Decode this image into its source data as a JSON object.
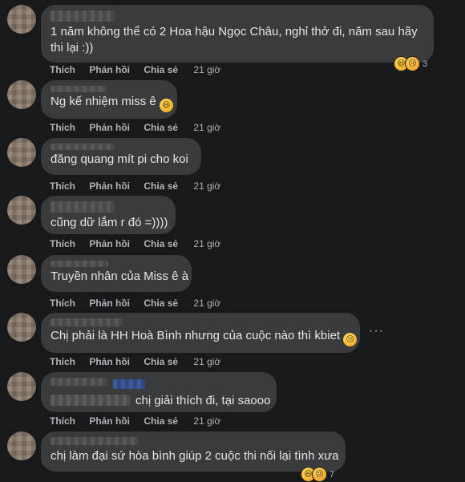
{
  "action_labels": {
    "like": "Thích",
    "reply": "Phản hồi",
    "share": "Chia sẻ"
  },
  "comments": [
    {
      "author": "",
      "text": "1 năm không thể có 2 Hoa hậu Ngọc Châu, nghỉ thở đi, năm sau hãy",
      "text2": "thi lại :))",
      "time": "21 giờ",
      "reaction_count": "3",
      "reaction_icons": [
        "laugh-emoji",
        "sad-emoji"
      ]
    },
    {
      "author": "",
      "text": "Ng kế nhiệm miss ê",
      "time": "21 giờ",
      "inline_icon": "laugh-emoji"
    },
    {
      "author": "Hoàng Thảo",
      "text": "đăng quang mít pi cho koi",
      "time": "21 giờ"
    },
    {
      "author": "",
      "text": "cũng dữ lắm r đó =))))",
      "time": "21 giờ"
    },
    {
      "author": "",
      "text": "Truyền nhân của Miss ê à",
      "time": "21 giờ"
    },
    {
      "author": "",
      "text": "Chị phải là HH Hoà Bình nhưng của cuộc nào thì kbiet",
      "time": "21 giờ",
      "inline_icon": "sad-emoji"
    },
    {
      "author": "",
      "text": "chị giải thích đi, tại saooo",
      "time": "21 giờ"
    },
    {
      "author": "",
      "text": "chị làm đại sứ hòa bình giúp 2 cuộc thi nối lại tình xưa",
      "time": "",
      "reaction_count": "7",
      "reaction_icons": [
        "laugh-emoji",
        "sad-emoji"
      ]
    }
  ],
  "more_options": "···"
}
